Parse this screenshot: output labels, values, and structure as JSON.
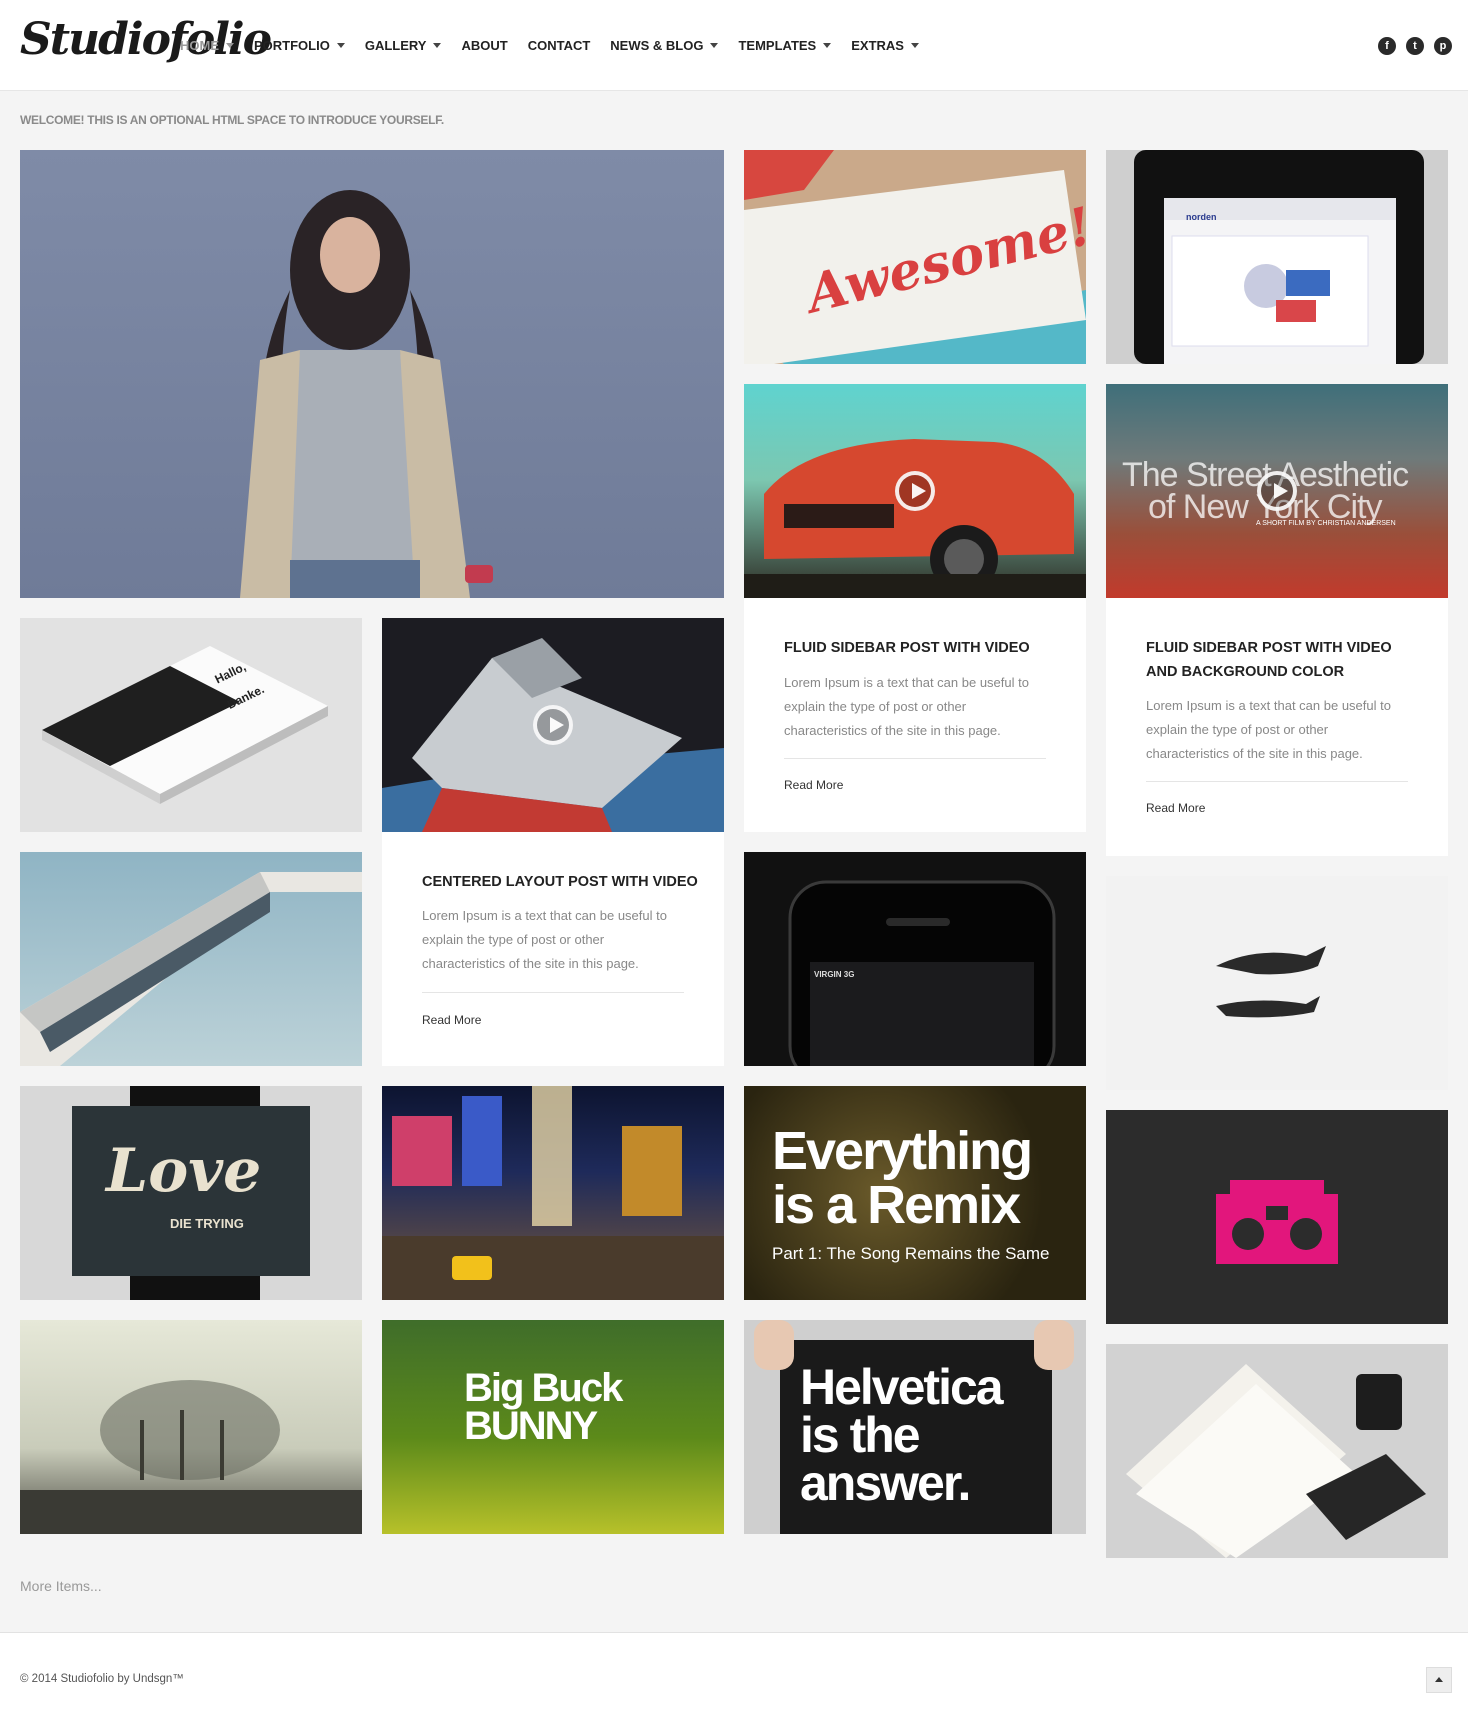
{
  "brand": {
    "logo": "Studiofolio"
  },
  "nav": [
    {
      "label": "HOME",
      "dropdown": true,
      "active": true
    },
    {
      "label": "PORTFOLIO",
      "dropdown": true
    },
    {
      "label": "GALLERY",
      "dropdown": true
    },
    {
      "label": "ABOUT",
      "dropdown": false
    },
    {
      "label": "CONTACT",
      "dropdown": false
    },
    {
      "label": "NEWS & BLOG",
      "dropdown": true
    },
    {
      "label": "TEMPLATES",
      "dropdown": true
    },
    {
      "label": "EXTRAS",
      "dropdown": true
    }
  ],
  "social": [
    {
      "icon": "facebook-icon",
      "glyph": "f"
    },
    {
      "icon": "twitter-icon",
      "glyph": "t"
    },
    {
      "icon": "pinterest-icon",
      "glyph": "p"
    }
  ],
  "intro": "WELCOME! THIS IS AN OPTIONAL HTML SPACE TO INTRODUCE YOURSELF.",
  "tiles": {
    "awesome": "Awesome!",
    "street_line1": "The Street Aesthetic",
    "street_line2": "of New York City",
    "street_credit": "A SHORT FILM BY CHRISTIAN ANDERSEN",
    "hallo": "Hallo,",
    "danke": "Danke.",
    "phone_carrier": "VIRGIN  3G",
    "love": "Love",
    "love_sub": "DIE TRYING",
    "remix_line1": "Everything",
    "remix_line2": "is a Remix",
    "remix_sub": "Part 1: The Song Remains the Same",
    "bunny_line1": "Big Buck",
    "bunny_line2": "BUNNY",
    "helvetica_line1": "Helvetica",
    "helvetica_line2": "is the",
    "helvetica_line3": "answer.",
    "norden": "norden"
  },
  "cards": {
    "centered": {
      "title": "CENTERED LAYOUT POST WITH VIDEO",
      "text": "Lorem Ipsum is a text that can be useful to explain the type of post or other characteristics of the site in this page.",
      "link": "Read More"
    },
    "fluid": {
      "title": "FLUID SIDEBAR POST WITH VIDEO",
      "text": "Lorem Ipsum is a text that can be useful to explain the type of post or other characteristics of the site in this page.",
      "link": "Read More"
    },
    "fluid_bg": {
      "title_line1": "FLUID SIDEBAR POST WITH VIDEO",
      "title_line2": "AND BACKGROUND COLOR",
      "text": "Lorem Ipsum is a text that can be useful to explain the type of post or other characteristics of the site in this page.",
      "link": "Read More"
    }
  },
  "more_items": "More Items...",
  "footer": {
    "copyright": "© 2014 Studiofolio by Undsgn™"
  }
}
